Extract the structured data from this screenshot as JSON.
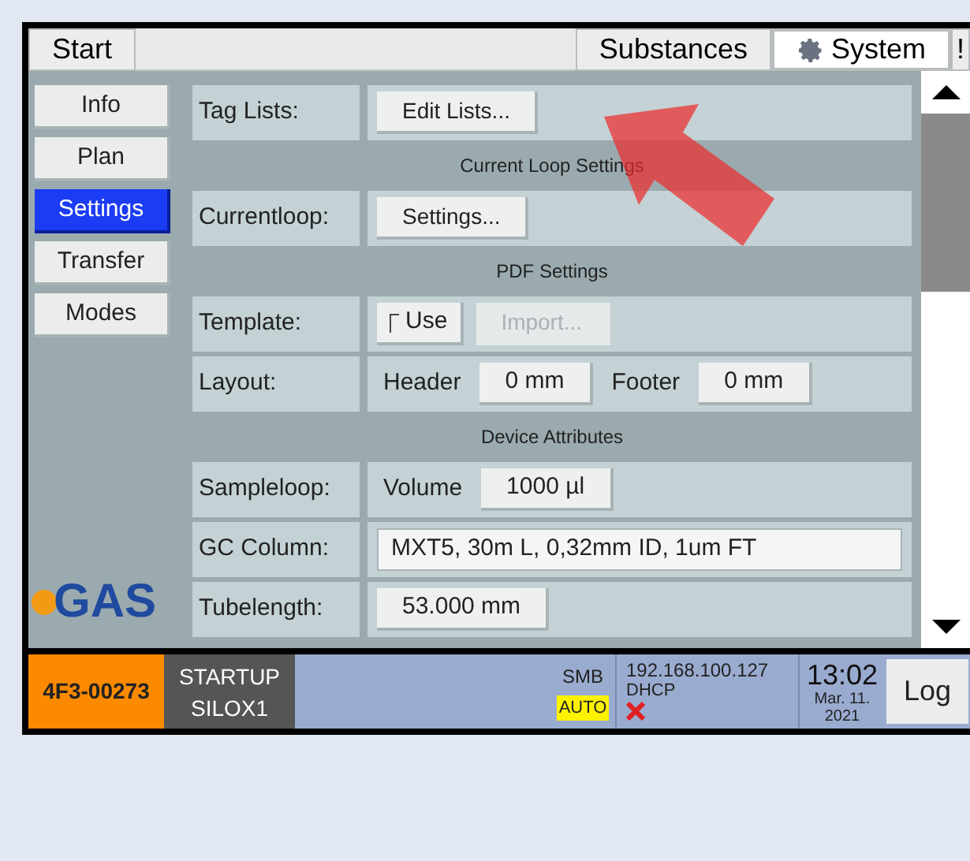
{
  "top_bar": {
    "tabs": [
      {
        "label": "Start",
        "selected": false
      },
      {
        "label": "Substances",
        "selected": false
      },
      {
        "label": "System",
        "selected": true
      }
    ],
    "alert": "!"
  },
  "nav": {
    "items": [
      {
        "label": "Info",
        "selected": false
      },
      {
        "label": "Plan",
        "selected": false
      },
      {
        "label": "Settings",
        "selected": true
      },
      {
        "label": "Transfer",
        "selected": false
      },
      {
        "label": "Modes",
        "selected": false
      }
    ]
  },
  "logo": {
    "text": "GAS"
  },
  "settings": [
    {
      "kind": "row",
      "label": "Tag Lists:",
      "controls": [
        {
          "kind": "button",
          "text": "Edit Lists...",
          "disabled": false
        }
      ]
    },
    {
      "kind": "section",
      "title": "Current Loop Settings"
    },
    {
      "kind": "row",
      "label": "Currentloop:",
      "controls": [
        {
          "kind": "button",
          "text": "Settings...",
          "disabled": false
        }
      ]
    },
    {
      "kind": "section",
      "title": "PDF Settings"
    },
    {
      "kind": "row",
      "label": "Template:",
      "controls": [
        {
          "kind": "checkbox",
          "text": "Use",
          "checked": false
        },
        {
          "kind": "button",
          "text": "Import...",
          "disabled": true
        }
      ]
    },
    {
      "kind": "row",
      "label": "Layout:",
      "controls": [
        {
          "kind": "text",
          "text": "Header"
        },
        {
          "kind": "field",
          "text": "0 mm"
        },
        {
          "kind": "text",
          "text": "Footer"
        },
        {
          "kind": "field",
          "text": "0 mm"
        }
      ]
    },
    {
      "kind": "section",
      "title": "Device Attributes"
    },
    {
      "kind": "row",
      "label": "Sampleloop:",
      "controls": [
        {
          "kind": "text",
          "text": "Volume"
        },
        {
          "kind": "field",
          "text": "1000 µl"
        }
      ]
    },
    {
      "kind": "row",
      "label": "GC Column:",
      "controls": [
        {
          "kind": "wide_field",
          "text": "MXT5, 30m L, 0,32mm ID, 1um FT"
        }
      ]
    },
    {
      "kind": "row",
      "label": "Tubelength:",
      "controls": [
        {
          "kind": "field",
          "text": "53.000 mm"
        }
      ]
    }
  ],
  "status_bar": {
    "device_id": "4F3-00273",
    "state": [
      "STARTUP",
      "SILOX1"
    ],
    "smb": "SMB",
    "mode": "AUTO",
    "ip": "192.168.100.127",
    "dhcp": "DHCP",
    "network_error": true,
    "time": "13:02",
    "date": [
      "Mar. 11.",
      "2021"
    ],
    "log_button": "Log"
  }
}
